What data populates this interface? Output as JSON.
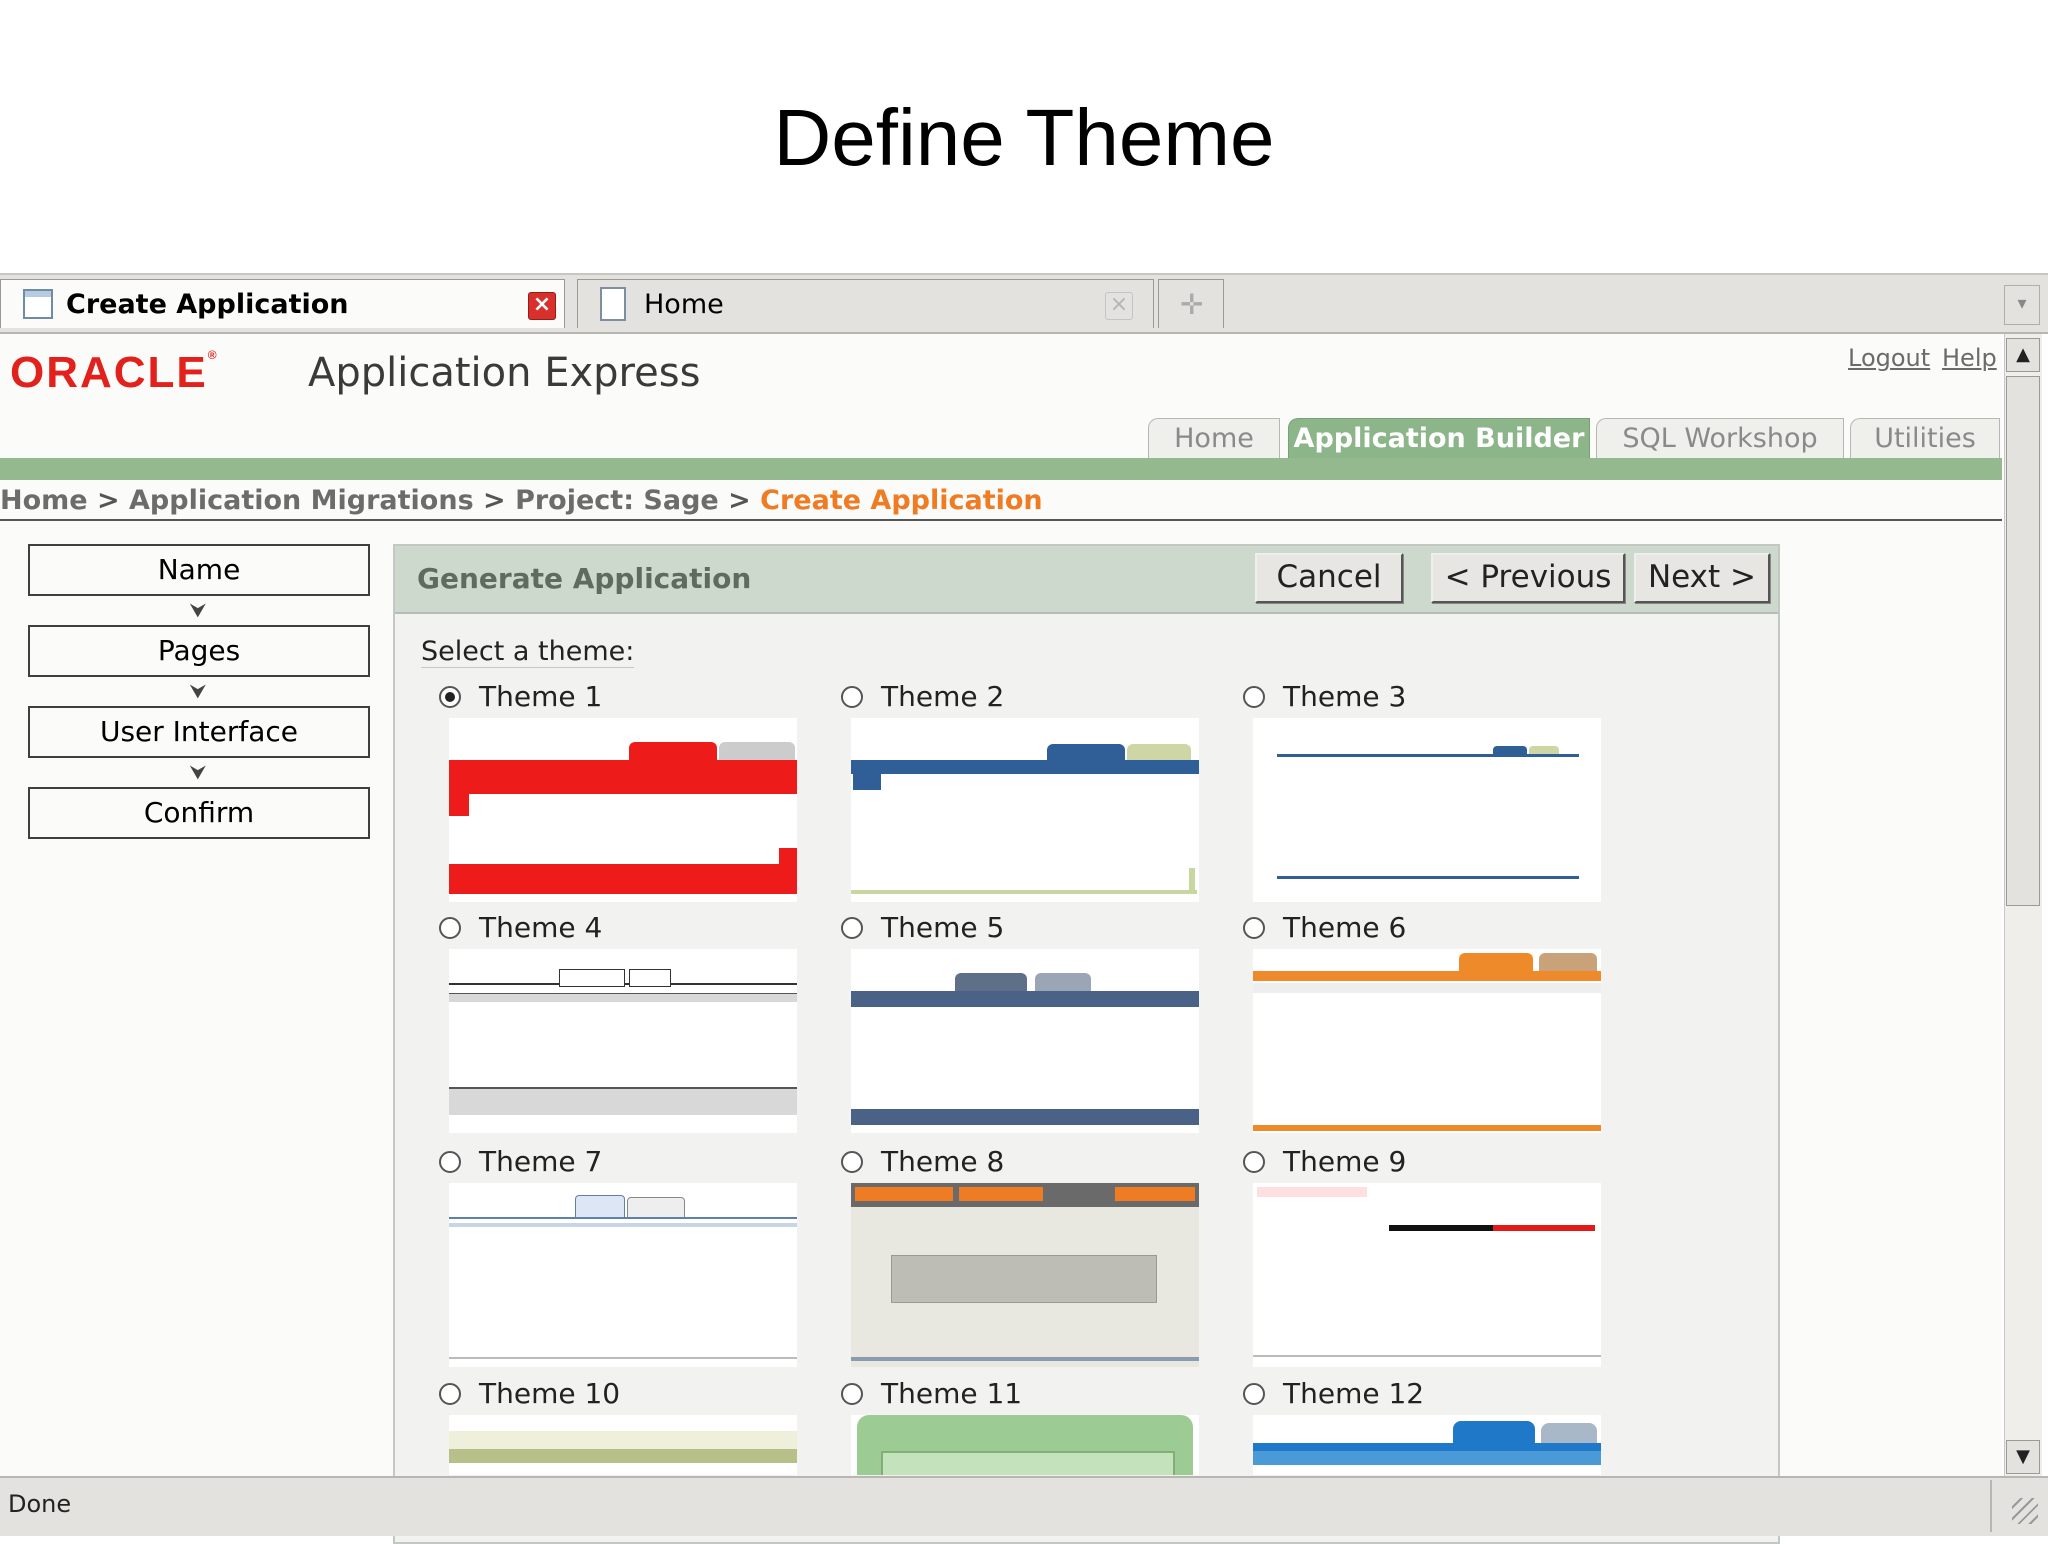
{
  "slide": {
    "title": "Define Theme"
  },
  "browser": {
    "tabs": [
      {
        "label": "Create Application",
        "active": true
      },
      {
        "label": "Home",
        "active": false
      }
    ]
  },
  "header": {
    "logo": "ORACLE",
    "product": "Application Express",
    "links": {
      "logout": "Logout",
      "help": "Help"
    },
    "nav_tabs": [
      "Home",
      "Application Builder",
      "SQL Workshop",
      "Utilities"
    ],
    "active_nav_tab": "Application Builder",
    "accent_color": "#8db58a",
    "brand_color": "#e2201c"
  },
  "breadcrumb": {
    "items": [
      "Home",
      "Application Migrations",
      "Project: Sage"
    ],
    "separator": ">",
    "current": "Create Application",
    "current_color": "#ef7b23"
  },
  "wizard": {
    "steps": [
      "Name",
      "Pages",
      "User Interface",
      "Confirm"
    ]
  },
  "region": {
    "title": "Generate Application",
    "buttons": {
      "cancel": "Cancel",
      "previous": "< Previous",
      "next": "Next >"
    },
    "select_label": "Select a theme:",
    "selected_theme": "Theme 1",
    "themes": [
      "Theme 1",
      "Theme 2",
      "Theme 3",
      "Theme 4",
      "Theme 5",
      "Theme 6",
      "Theme 7",
      "Theme 8",
      "Theme 9",
      "Theme 10",
      "Theme 11",
      "Theme 12"
    ]
  },
  "status_bar": {
    "text": "Done"
  }
}
